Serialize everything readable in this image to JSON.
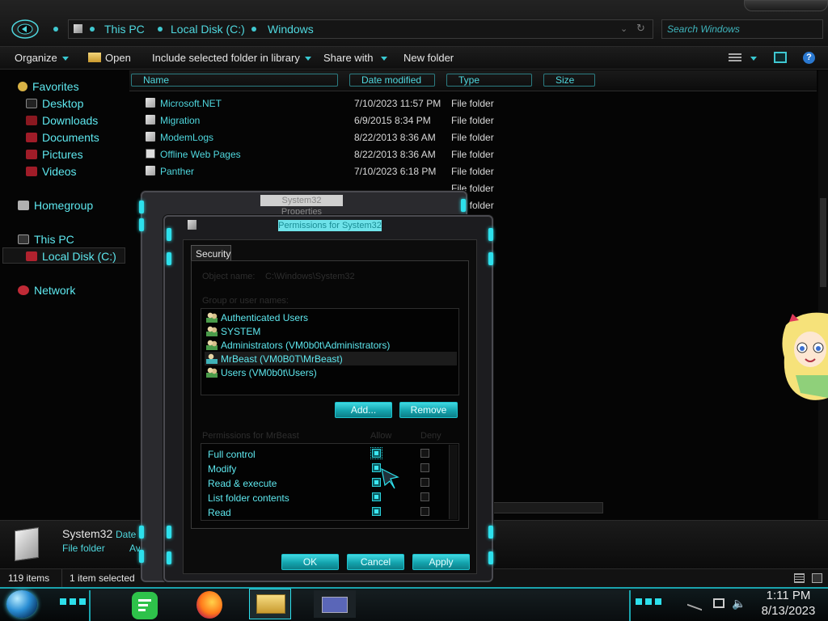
{
  "address": {
    "segments": [
      "This PC",
      "Local Disk (C:)",
      "Windows"
    ]
  },
  "search": {
    "placeholder": "Search Windows"
  },
  "toolbar": {
    "organize": "Organize",
    "open": "Open",
    "include": "Include selected folder in library",
    "share": "Share with",
    "new_folder": "New folder"
  },
  "sidebar": {
    "favorites": "Favorites",
    "desktop": "Desktop",
    "downloads": "Downloads",
    "documents": "Documents",
    "pictures": "Pictures",
    "videos": "Videos",
    "homegroup": "Homegroup",
    "this_pc": "This PC",
    "local_disk": "Local Disk (C:)",
    "network": "Network"
  },
  "columns": {
    "name": "Name",
    "date": "Date modified",
    "type": "Type",
    "size": "Size"
  },
  "files": [
    {
      "name": "Microsoft.NET",
      "date": "7/10/2023 11:57 PM",
      "type": "File folder"
    },
    {
      "name": "Migration",
      "date": "6/9/2015 8:34 PM",
      "type": "File folder"
    },
    {
      "name": "ModemLogs",
      "date": "8/22/2013 8:36 AM",
      "type": "File folder"
    },
    {
      "name": "Offline Web Pages",
      "date": "8/22/2013 8:36 AM",
      "type": "File folder"
    },
    {
      "name": "Panther",
      "date": "7/10/2023 6:18 PM",
      "type": "File folder"
    },
    {
      "name": "",
      "date": "",
      "type": "File folder"
    },
    {
      "name": "",
      "date": "",
      "type": "File folder"
    }
  ],
  "details": {
    "name": "System32",
    "type": "File folder",
    "date_label": "Date",
    "extra": "Av"
  },
  "status": {
    "count": "119 items",
    "selected": "1 item selected"
  },
  "clock": {
    "time": "1:11 PM",
    "date": "8/13/2023"
  },
  "dialog_properties": {
    "title": "System32 Properties"
  },
  "dialog_permissions": {
    "title": "Permissions for System32",
    "tab": "Security",
    "object_label": "Object name:",
    "object_value": "C:\\Windows\\System32",
    "groups_label": "Group or user names:",
    "groups": [
      "Authenticated Users",
      "SYSTEM",
      "Administrators (VM0b0t\\Administrators)",
      "MrBeast (VM0B0T\\MrBeast)",
      "Users (VM0b0t\\Users)"
    ],
    "add": "Add...",
    "remove": "Remove",
    "perms_label": "Permissions for MrBeast",
    "allow": "Allow",
    "deny": "Deny",
    "permissions": [
      {
        "name": "Full control",
        "allow": true,
        "deny": false
      },
      {
        "name": "Modify",
        "allow": true,
        "deny": false
      },
      {
        "name": "Read & execute",
        "allow": true,
        "deny": false
      },
      {
        "name": "List folder contents",
        "allow": true,
        "deny": false
      },
      {
        "name": "Read",
        "allow": true,
        "deny": false
      }
    ],
    "ok": "OK",
    "cancel": "Cancel",
    "apply": "Apply"
  },
  "colors": {
    "accent": "#2de0ec",
    "text": "#5ee8ef",
    "bg": "#050505"
  }
}
